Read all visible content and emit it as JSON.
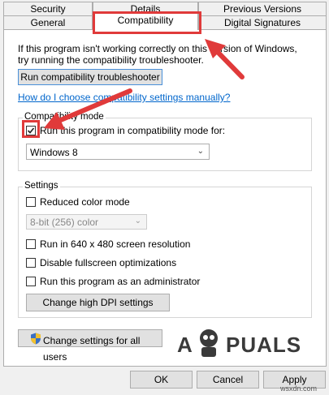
{
  "tabs": {
    "row1": [
      "Security",
      "Details",
      "Previous Versions"
    ],
    "row2": [
      "General",
      "Compatibility",
      "Digital Signatures"
    ]
  },
  "intro_text_line1": "If this program isn't working correctly on this version of Windows,",
  "intro_text_line2": "try running the compatibility troubleshooter.",
  "troubleshooter_button": "Run compatibility troubleshooter",
  "manual_link": "How do I choose compatibility settings manually?",
  "compat_mode": {
    "legend": "Compatibility mode",
    "checkbox_label": "Run this program in compatibility mode for:",
    "checked": true,
    "selected_os": "Windows 8"
  },
  "settings": {
    "legend": "Settings",
    "reduced_color": "Reduced color mode",
    "color_option": "8-bit (256) color",
    "resolution": "Run in 640 x 480 screen resolution",
    "fullscreen": "Disable fullscreen optimizations",
    "admin": "Run this program as an administrator",
    "dpi_button": "Change high DPI settings"
  },
  "all_users_button": "Change settings for all users",
  "watermark_left": "A",
  "watermark_right": "PUALS",
  "site_watermark": "wsxdn.com",
  "footer": {
    "ok": "OK",
    "cancel": "Cancel",
    "apply": "Apply"
  },
  "colors": {
    "annotation_red": "#e03a3a",
    "link_blue": "#0066cc",
    "window_bg": "#f0f0f0"
  }
}
